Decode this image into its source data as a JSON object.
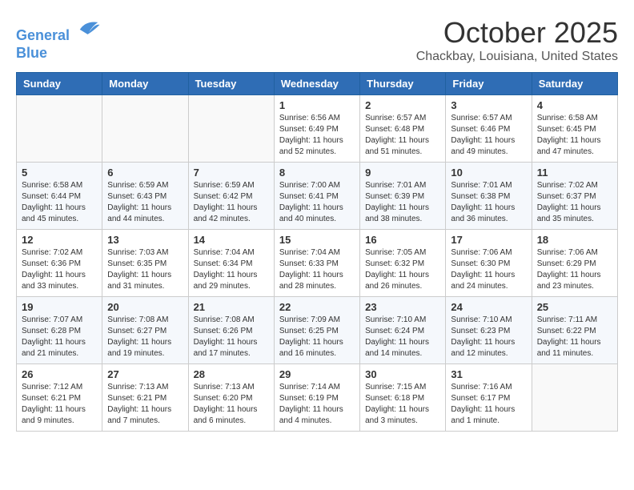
{
  "header": {
    "logo_line1": "General",
    "logo_line2": "Blue",
    "month": "October 2025",
    "location": "Chackbay, Louisiana, United States"
  },
  "days_of_week": [
    "Sunday",
    "Monday",
    "Tuesday",
    "Wednesday",
    "Thursday",
    "Friday",
    "Saturday"
  ],
  "weeks": [
    [
      {
        "day": "",
        "info": ""
      },
      {
        "day": "",
        "info": ""
      },
      {
        "day": "",
        "info": ""
      },
      {
        "day": "1",
        "info": "Sunrise: 6:56 AM\nSunset: 6:49 PM\nDaylight: 11 hours and 52 minutes."
      },
      {
        "day": "2",
        "info": "Sunrise: 6:57 AM\nSunset: 6:48 PM\nDaylight: 11 hours and 51 minutes."
      },
      {
        "day": "3",
        "info": "Sunrise: 6:57 AM\nSunset: 6:46 PM\nDaylight: 11 hours and 49 minutes."
      },
      {
        "day": "4",
        "info": "Sunrise: 6:58 AM\nSunset: 6:45 PM\nDaylight: 11 hours and 47 minutes."
      }
    ],
    [
      {
        "day": "5",
        "info": "Sunrise: 6:58 AM\nSunset: 6:44 PM\nDaylight: 11 hours and 45 minutes."
      },
      {
        "day": "6",
        "info": "Sunrise: 6:59 AM\nSunset: 6:43 PM\nDaylight: 11 hours and 44 minutes."
      },
      {
        "day": "7",
        "info": "Sunrise: 6:59 AM\nSunset: 6:42 PM\nDaylight: 11 hours and 42 minutes."
      },
      {
        "day": "8",
        "info": "Sunrise: 7:00 AM\nSunset: 6:41 PM\nDaylight: 11 hours and 40 minutes."
      },
      {
        "day": "9",
        "info": "Sunrise: 7:01 AM\nSunset: 6:39 PM\nDaylight: 11 hours and 38 minutes."
      },
      {
        "day": "10",
        "info": "Sunrise: 7:01 AM\nSunset: 6:38 PM\nDaylight: 11 hours and 36 minutes."
      },
      {
        "day": "11",
        "info": "Sunrise: 7:02 AM\nSunset: 6:37 PM\nDaylight: 11 hours and 35 minutes."
      }
    ],
    [
      {
        "day": "12",
        "info": "Sunrise: 7:02 AM\nSunset: 6:36 PM\nDaylight: 11 hours and 33 minutes."
      },
      {
        "day": "13",
        "info": "Sunrise: 7:03 AM\nSunset: 6:35 PM\nDaylight: 11 hours and 31 minutes."
      },
      {
        "day": "14",
        "info": "Sunrise: 7:04 AM\nSunset: 6:34 PM\nDaylight: 11 hours and 29 minutes."
      },
      {
        "day": "15",
        "info": "Sunrise: 7:04 AM\nSunset: 6:33 PM\nDaylight: 11 hours and 28 minutes."
      },
      {
        "day": "16",
        "info": "Sunrise: 7:05 AM\nSunset: 6:32 PM\nDaylight: 11 hours and 26 minutes."
      },
      {
        "day": "17",
        "info": "Sunrise: 7:06 AM\nSunset: 6:30 PM\nDaylight: 11 hours and 24 minutes."
      },
      {
        "day": "18",
        "info": "Sunrise: 7:06 AM\nSunset: 6:29 PM\nDaylight: 11 hours and 23 minutes."
      }
    ],
    [
      {
        "day": "19",
        "info": "Sunrise: 7:07 AM\nSunset: 6:28 PM\nDaylight: 11 hours and 21 minutes."
      },
      {
        "day": "20",
        "info": "Sunrise: 7:08 AM\nSunset: 6:27 PM\nDaylight: 11 hours and 19 minutes."
      },
      {
        "day": "21",
        "info": "Sunrise: 7:08 AM\nSunset: 6:26 PM\nDaylight: 11 hours and 17 minutes."
      },
      {
        "day": "22",
        "info": "Sunrise: 7:09 AM\nSunset: 6:25 PM\nDaylight: 11 hours and 16 minutes."
      },
      {
        "day": "23",
        "info": "Sunrise: 7:10 AM\nSunset: 6:24 PM\nDaylight: 11 hours and 14 minutes."
      },
      {
        "day": "24",
        "info": "Sunrise: 7:10 AM\nSunset: 6:23 PM\nDaylight: 11 hours and 12 minutes."
      },
      {
        "day": "25",
        "info": "Sunrise: 7:11 AM\nSunset: 6:22 PM\nDaylight: 11 hours and 11 minutes."
      }
    ],
    [
      {
        "day": "26",
        "info": "Sunrise: 7:12 AM\nSunset: 6:21 PM\nDaylight: 11 hours and 9 minutes."
      },
      {
        "day": "27",
        "info": "Sunrise: 7:13 AM\nSunset: 6:21 PM\nDaylight: 11 hours and 7 minutes."
      },
      {
        "day": "28",
        "info": "Sunrise: 7:13 AM\nSunset: 6:20 PM\nDaylight: 11 hours and 6 minutes."
      },
      {
        "day": "29",
        "info": "Sunrise: 7:14 AM\nSunset: 6:19 PM\nDaylight: 11 hours and 4 minutes."
      },
      {
        "day": "30",
        "info": "Sunrise: 7:15 AM\nSunset: 6:18 PM\nDaylight: 11 hours and 3 minutes."
      },
      {
        "day": "31",
        "info": "Sunrise: 7:16 AM\nSunset: 6:17 PM\nDaylight: 11 hours and 1 minute."
      },
      {
        "day": "",
        "info": ""
      }
    ]
  ]
}
